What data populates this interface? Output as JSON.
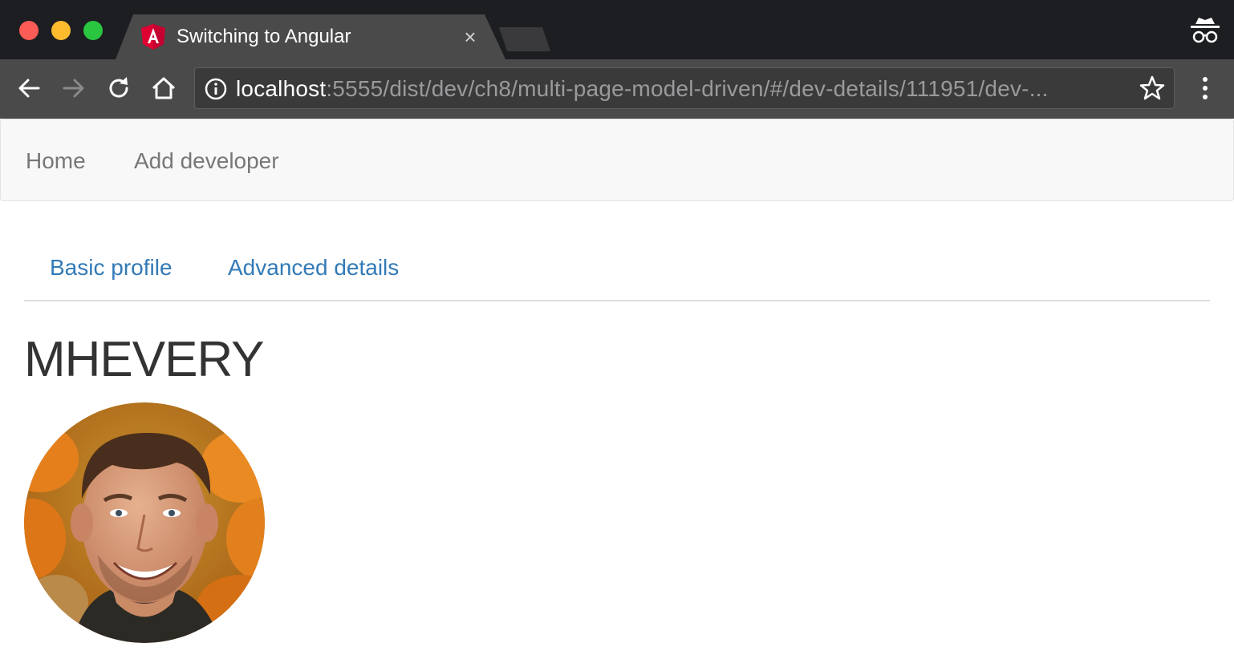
{
  "browser": {
    "tab_title": "Switching to Angular",
    "tab_close_icon": "×",
    "url_host": "localhost",
    "url_path": ":5555/dist/dev/ch8/multi-page-model-driven/#/dev-details/111951/dev-..."
  },
  "navbar": {
    "items": [
      {
        "label": "Home"
      },
      {
        "label": "Add developer"
      }
    ]
  },
  "profile_tabs": [
    {
      "label": "Basic profile"
    },
    {
      "label": "Advanced details"
    }
  ],
  "developer": {
    "name": "MHEVERY"
  },
  "colors": {
    "link": "#337ab7",
    "nav_text": "#777777",
    "heading": "#333333",
    "chrome_dark": "#1d1e21",
    "chrome_toolbar": "#4a4a4b"
  },
  "icons": [
    "angular-favicon-icon",
    "close-icon",
    "incognito-icon",
    "back-arrow-icon",
    "forward-arrow-icon",
    "reload-icon",
    "home-icon",
    "info-icon",
    "star-icon",
    "kebab-menu-icon"
  ]
}
